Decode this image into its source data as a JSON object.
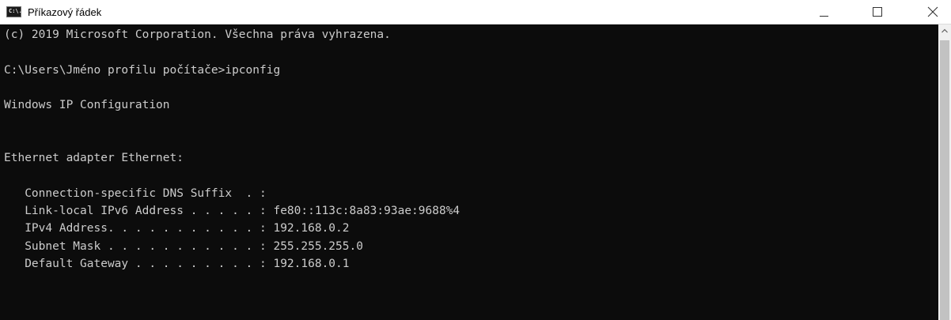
{
  "window": {
    "title": "Příkazový řádek",
    "icon": "cmd-app-icon",
    "icon_text": "C:\\."
  },
  "controls": {
    "minimize_icon": "minimize-icon",
    "maximize_icon": "maximize-icon",
    "close_icon": "close-icon"
  },
  "console": {
    "lines": [
      "(c) 2019 Microsoft Corporation. Všechna práva vyhrazena.",
      "",
      "C:\\Users\\Jméno profilu počítače>ipconfig",
      "",
      "Windows IP Configuration",
      "",
      "",
      "Ethernet adapter Ethernet:",
      "",
      "   Connection-specific DNS Suffix  . :",
      "   Link-local IPv6 Address . . . . . : fe80::113c:8a83:93ae:9688%4",
      "   IPv4 Address. . . . . . . . . . . : 192.168.0.2",
      "   Subnet Mask . . . . . . . . . . . : 255.255.255.0",
      "   Default Gateway . . . . . . . . . : 192.168.0.1"
    ],
    "foreground": "#cccccc",
    "background": "#0c0c0c"
  },
  "scrollbar": {
    "up_icon": "scroll-up-arrow-icon"
  }
}
